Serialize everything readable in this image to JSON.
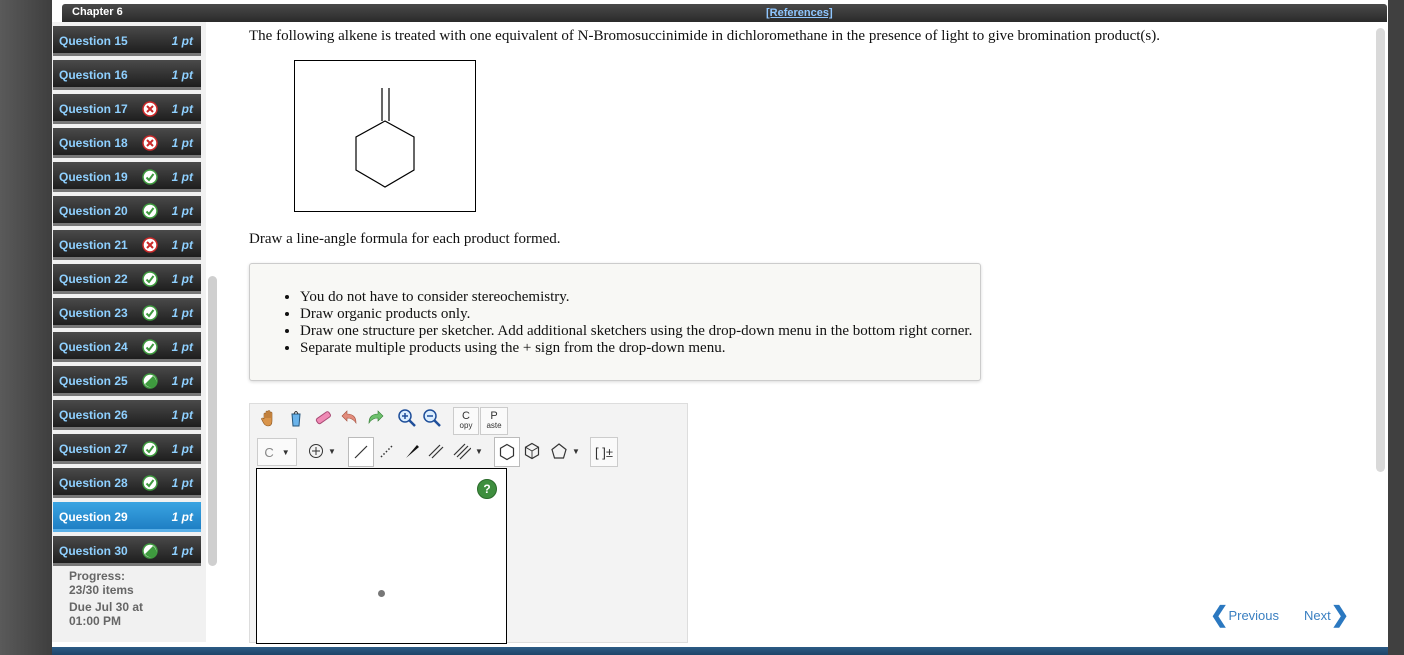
{
  "header": {
    "chapter": "Chapter 6",
    "references": "[References]"
  },
  "sidebar": {
    "items": [
      {
        "label": "Question 15",
        "points": "1 pt",
        "status": "none"
      },
      {
        "label": "Question 16",
        "points": "1 pt",
        "status": "none"
      },
      {
        "label": "Question 17",
        "points": "1 pt",
        "status": "incorrect"
      },
      {
        "label": "Question 18",
        "points": "1 pt",
        "status": "incorrect"
      },
      {
        "label": "Question 19",
        "points": "1 pt",
        "status": "correct"
      },
      {
        "label": "Question 20",
        "points": "1 pt",
        "status": "correct"
      },
      {
        "label": "Question 21",
        "points": "1 pt",
        "status": "incorrect"
      },
      {
        "label": "Question 22",
        "points": "1 pt",
        "status": "correct"
      },
      {
        "label": "Question 23",
        "points": "1 pt",
        "status": "correct"
      },
      {
        "label": "Question 24",
        "points": "1 pt",
        "status": "correct"
      },
      {
        "label": "Question 25",
        "points": "1 pt",
        "status": "partial"
      },
      {
        "label": "Question 26",
        "points": "1 pt",
        "status": "none"
      },
      {
        "label": "Question 27",
        "points": "1 pt",
        "status": "correct"
      },
      {
        "label": "Question 28",
        "points": "1 pt",
        "status": "correct"
      },
      {
        "label": "Question 29",
        "points": "1 pt",
        "status": "active"
      },
      {
        "label": "Question 30",
        "points": "1 pt",
        "status": "partial"
      }
    ],
    "progress_label": "Progress:",
    "progress_value": "23/30 items",
    "due_line1": "Due Jul 30 at",
    "due_line2": "01:00 PM"
  },
  "question": {
    "prompt": "The following alkene is treated with one equivalent of N-Bromosuccinimide in dichloromethane in the presence of light to give bromination product(s).",
    "instruction": "Draw a line-angle formula for each product formed.",
    "bullets": [
      "You do not have to consider stereochemistry.",
      "Draw organic products only.",
      "Draw one structure per sketcher. Add additional sketchers using the drop-down menu in the bottom right corner.",
      "Separate multiple products using the + sign from the drop-down menu."
    ]
  },
  "sketcher": {
    "copy_top": "C",
    "copy_bottom": "opy",
    "paste_top": "P",
    "paste_bottom": "aste",
    "atom_label": "C",
    "bracket_label": "[ ]±",
    "help_label": "?"
  },
  "navigation": {
    "previous": "Previous",
    "next": "Next"
  },
  "colors": {
    "accent": "#2b8fd6",
    "correct": "#3e9a3e",
    "incorrect": "#cc2a2a"
  }
}
